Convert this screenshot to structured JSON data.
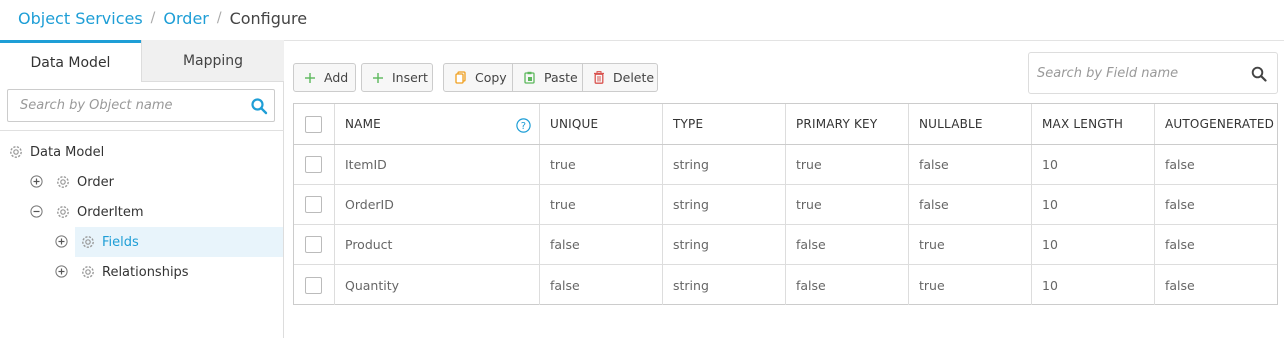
{
  "breadcrumb": {
    "root": "Object Services",
    "parent": "Order",
    "current": "Configure",
    "separator": "/"
  },
  "tabs": {
    "data_model": "Data Model",
    "mapping": "Mapping"
  },
  "object_search": {
    "placeholder": "Search by Object name"
  },
  "tree": {
    "root": "Data Model",
    "order": "Order",
    "order_item": "OrderItem",
    "fields": "Fields",
    "relationships": "Relationships"
  },
  "toolbar": {
    "add": "Add",
    "insert": "Insert",
    "copy": "Copy",
    "paste": "Paste",
    "delete": "Delete"
  },
  "field_search": {
    "placeholder": "Search by Field name"
  },
  "grid": {
    "headers": [
      "NAME",
      "UNIQUE",
      "TYPE",
      "PRIMARY KEY",
      "NULLABLE",
      "MAX LENGTH",
      "AUTOGENERATED"
    ],
    "help_glyph": "?",
    "rows": [
      [
        "ItemID",
        "true",
        "string",
        "true",
        "false",
        "10",
        "false"
      ],
      [
        "OrderID",
        "true",
        "string",
        "true",
        "false",
        "10",
        "false"
      ],
      [
        "Product",
        "false",
        "string",
        "false",
        "true",
        "10",
        "false"
      ],
      [
        "Quantity",
        "false",
        "string",
        "false",
        "true",
        "10",
        "false"
      ]
    ]
  },
  "colors": {
    "accent": "#1e9ed6",
    "add_icon": "#5cb85c",
    "copy_icon": "#f0a020",
    "paste_icon": "#5cb85c",
    "delete_icon": "#d9534f"
  }
}
